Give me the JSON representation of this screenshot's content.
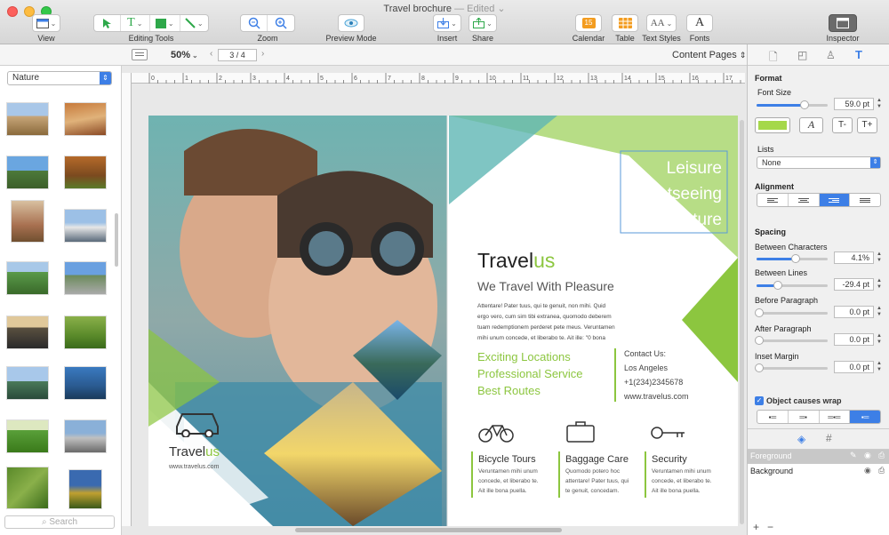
{
  "window": {
    "title": "Travel brochure",
    "edited": "— Edited"
  },
  "toolbar": {
    "view": "View",
    "editing_tools": "Editing Tools",
    "zoom": "Zoom",
    "preview_mode": "Preview Mode",
    "insert": "Insert",
    "share": "Share",
    "calendar": "Calendar",
    "table": "Table",
    "text_styles": "Text Styles",
    "fonts": "Fonts",
    "inspector": "Inspector"
  },
  "subbar": {
    "zoom_level": "50%",
    "page_indicator": "3 / 4",
    "content_pages": "Content Pages"
  },
  "left_panel": {
    "category": "Nature",
    "search_placeholder": "Search"
  },
  "ruler": {
    "ticks": [
      "0",
      "1",
      "2",
      "3",
      "4",
      "5",
      "6",
      "7",
      "8",
      "9",
      "10",
      "11",
      "12",
      "13",
      "14",
      "15",
      "16",
      "17"
    ]
  },
  "brochure": {
    "cover_brand": {
      "main": "Travel",
      "accent": "us"
    },
    "cover_url": "www.travelus.com",
    "headline_lines": [
      "Leisure",
      "Sightseeing",
      "Adventure"
    ],
    "brand": {
      "main": "Travel",
      "accent": "us"
    },
    "tagline": "We Travel With Pleasure",
    "body": [
      "Attentare! Pater tuus, qui te genuit, non mihi. Quid",
      "ergo vero, cum sim tibi extranea, quomodo deberem",
      "tuam redemptionem perderet pete meus. Veruntamen",
      "mihi unum concede, et liberabo te. Ait ille: \"0 bona"
    ],
    "services": [
      "Exciting Locations",
      "Professional Service",
      "Best Routes"
    ],
    "contact": [
      "Contact Us:",
      "Los Angeles",
      "+1(234)2345678",
      "www.travelus.com"
    ],
    "features": [
      {
        "title": "Bicycle Tours",
        "desc": [
          "Veruntamen mihi unum",
          "concede, et liberabo te.",
          "Ait ille bona puella."
        ]
      },
      {
        "title": "Baggage Care",
        "desc": [
          "Quomodo potero hoc",
          "attentare! Pater tuus, qui",
          "te genuit, concedam."
        ]
      },
      {
        "title": "Security",
        "desc": [
          "Veruntamen mihi unum",
          "concede, et liberabo te.",
          "Ait ille bona puella."
        ]
      }
    ]
  },
  "inspector": {
    "format": "Format",
    "font_size_label": "Font Size",
    "font_size": "59.0 pt",
    "font_size_fraction": 0.67,
    "lists_label": "Lists",
    "lists_value": "None",
    "alignment_label": "Alignment",
    "spacing_label": "Spacing",
    "between_chars_label": "Between Characters",
    "between_chars": "4.1%",
    "between_chars_fraction": 0.55,
    "between_lines_label": "Between Lines",
    "between_lines": "-29.4 pt",
    "between_lines_fraction": 0.3,
    "before_para_label": "Before Paragraph",
    "before_para": "0.0 pt",
    "after_para_label": "After Paragraph",
    "after_para": "0.0 pt",
    "inset_label": "Inset Margin",
    "inset": "0.0 pt",
    "wrap_label": "Object causes wrap",
    "layers": [
      "Foreground",
      "Background"
    ]
  },
  "colors": {
    "accent_green": "#8cc63f",
    "teal": "#5fb7b4",
    "blue": "#3d7fe6"
  }
}
